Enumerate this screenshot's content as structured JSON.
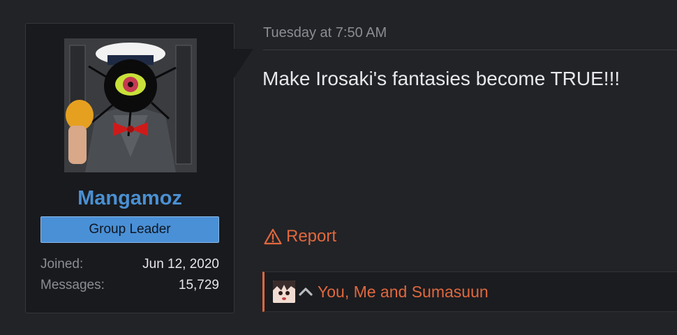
{
  "user": {
    "avatar_icon": "user-avatar",
    "username": "Mangamoz",
    "banner": "Group Leader",
    "stats": [
      {
        "label": "Joined:",
        "value": "Jun 12, 2020"
      },
      {
        "label": "Messages:",
        "value": "15,729"
      }
    ]
  },
  "message": {
    "timestamp": "Tuesday at 7:50 AM",
    "body": "Make Irosaki's fantasies become TRUE!!!",
    "report_label": "Report",
    "report_icon": "warning-triangle-icon"
  },
  "reactions": {
    "summary": "You, Me and Sumasuun",
    "reaction_icon": "chevron-up-icon",
    "avatar_icon": "reactor-avatar"
  },
  "colors": {
    "accent": "#e0683d",
    "username": "#4a90d2",
    "banner_bg": "#4a90d6",
    "page_bg": "#222327",
    "card_bg": "#191a1e"
  }
}
